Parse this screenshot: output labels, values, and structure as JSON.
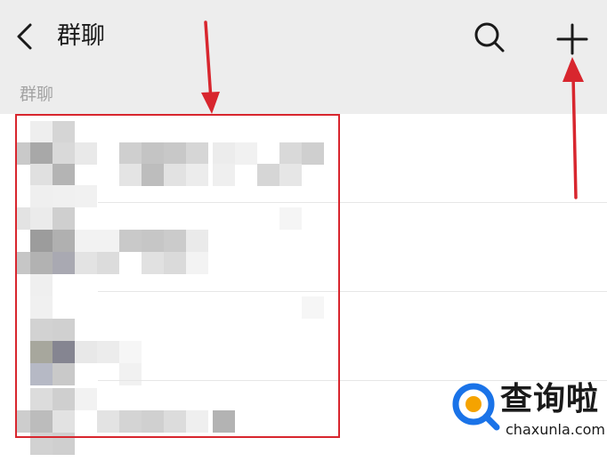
{
  "header": {
    "back_icon": "chevron-left-icon",
    "title": "群聊",
    "search_icon": "search-icon",
    "add_icon": "plus-icon"
  },
  "section": {
    "label": "群聊"
  },
  "group_list": {
    "row_count": 4,
    "content": "pixelated/obscured group names and avatars"
  },
  "annotations": {
    "highlight_color": "#d8262e",
    "arrow_color": "#d8262e"
  },
  "watermark": {
    "brand_cn": "查询啦",
    "brand_en": "chaxunla.com",
    "logo_colors": [
      "#1a73e8",
      "#f5a300"
    ]
  },
  "colors": {
    "header_bg": "#ededed",
    "title": "#1a1a1a",
    "section_label": "#a3a3a3",
    "list_bg": "#ffffff",
    "divider": "#e6e6e6"
  }
}
